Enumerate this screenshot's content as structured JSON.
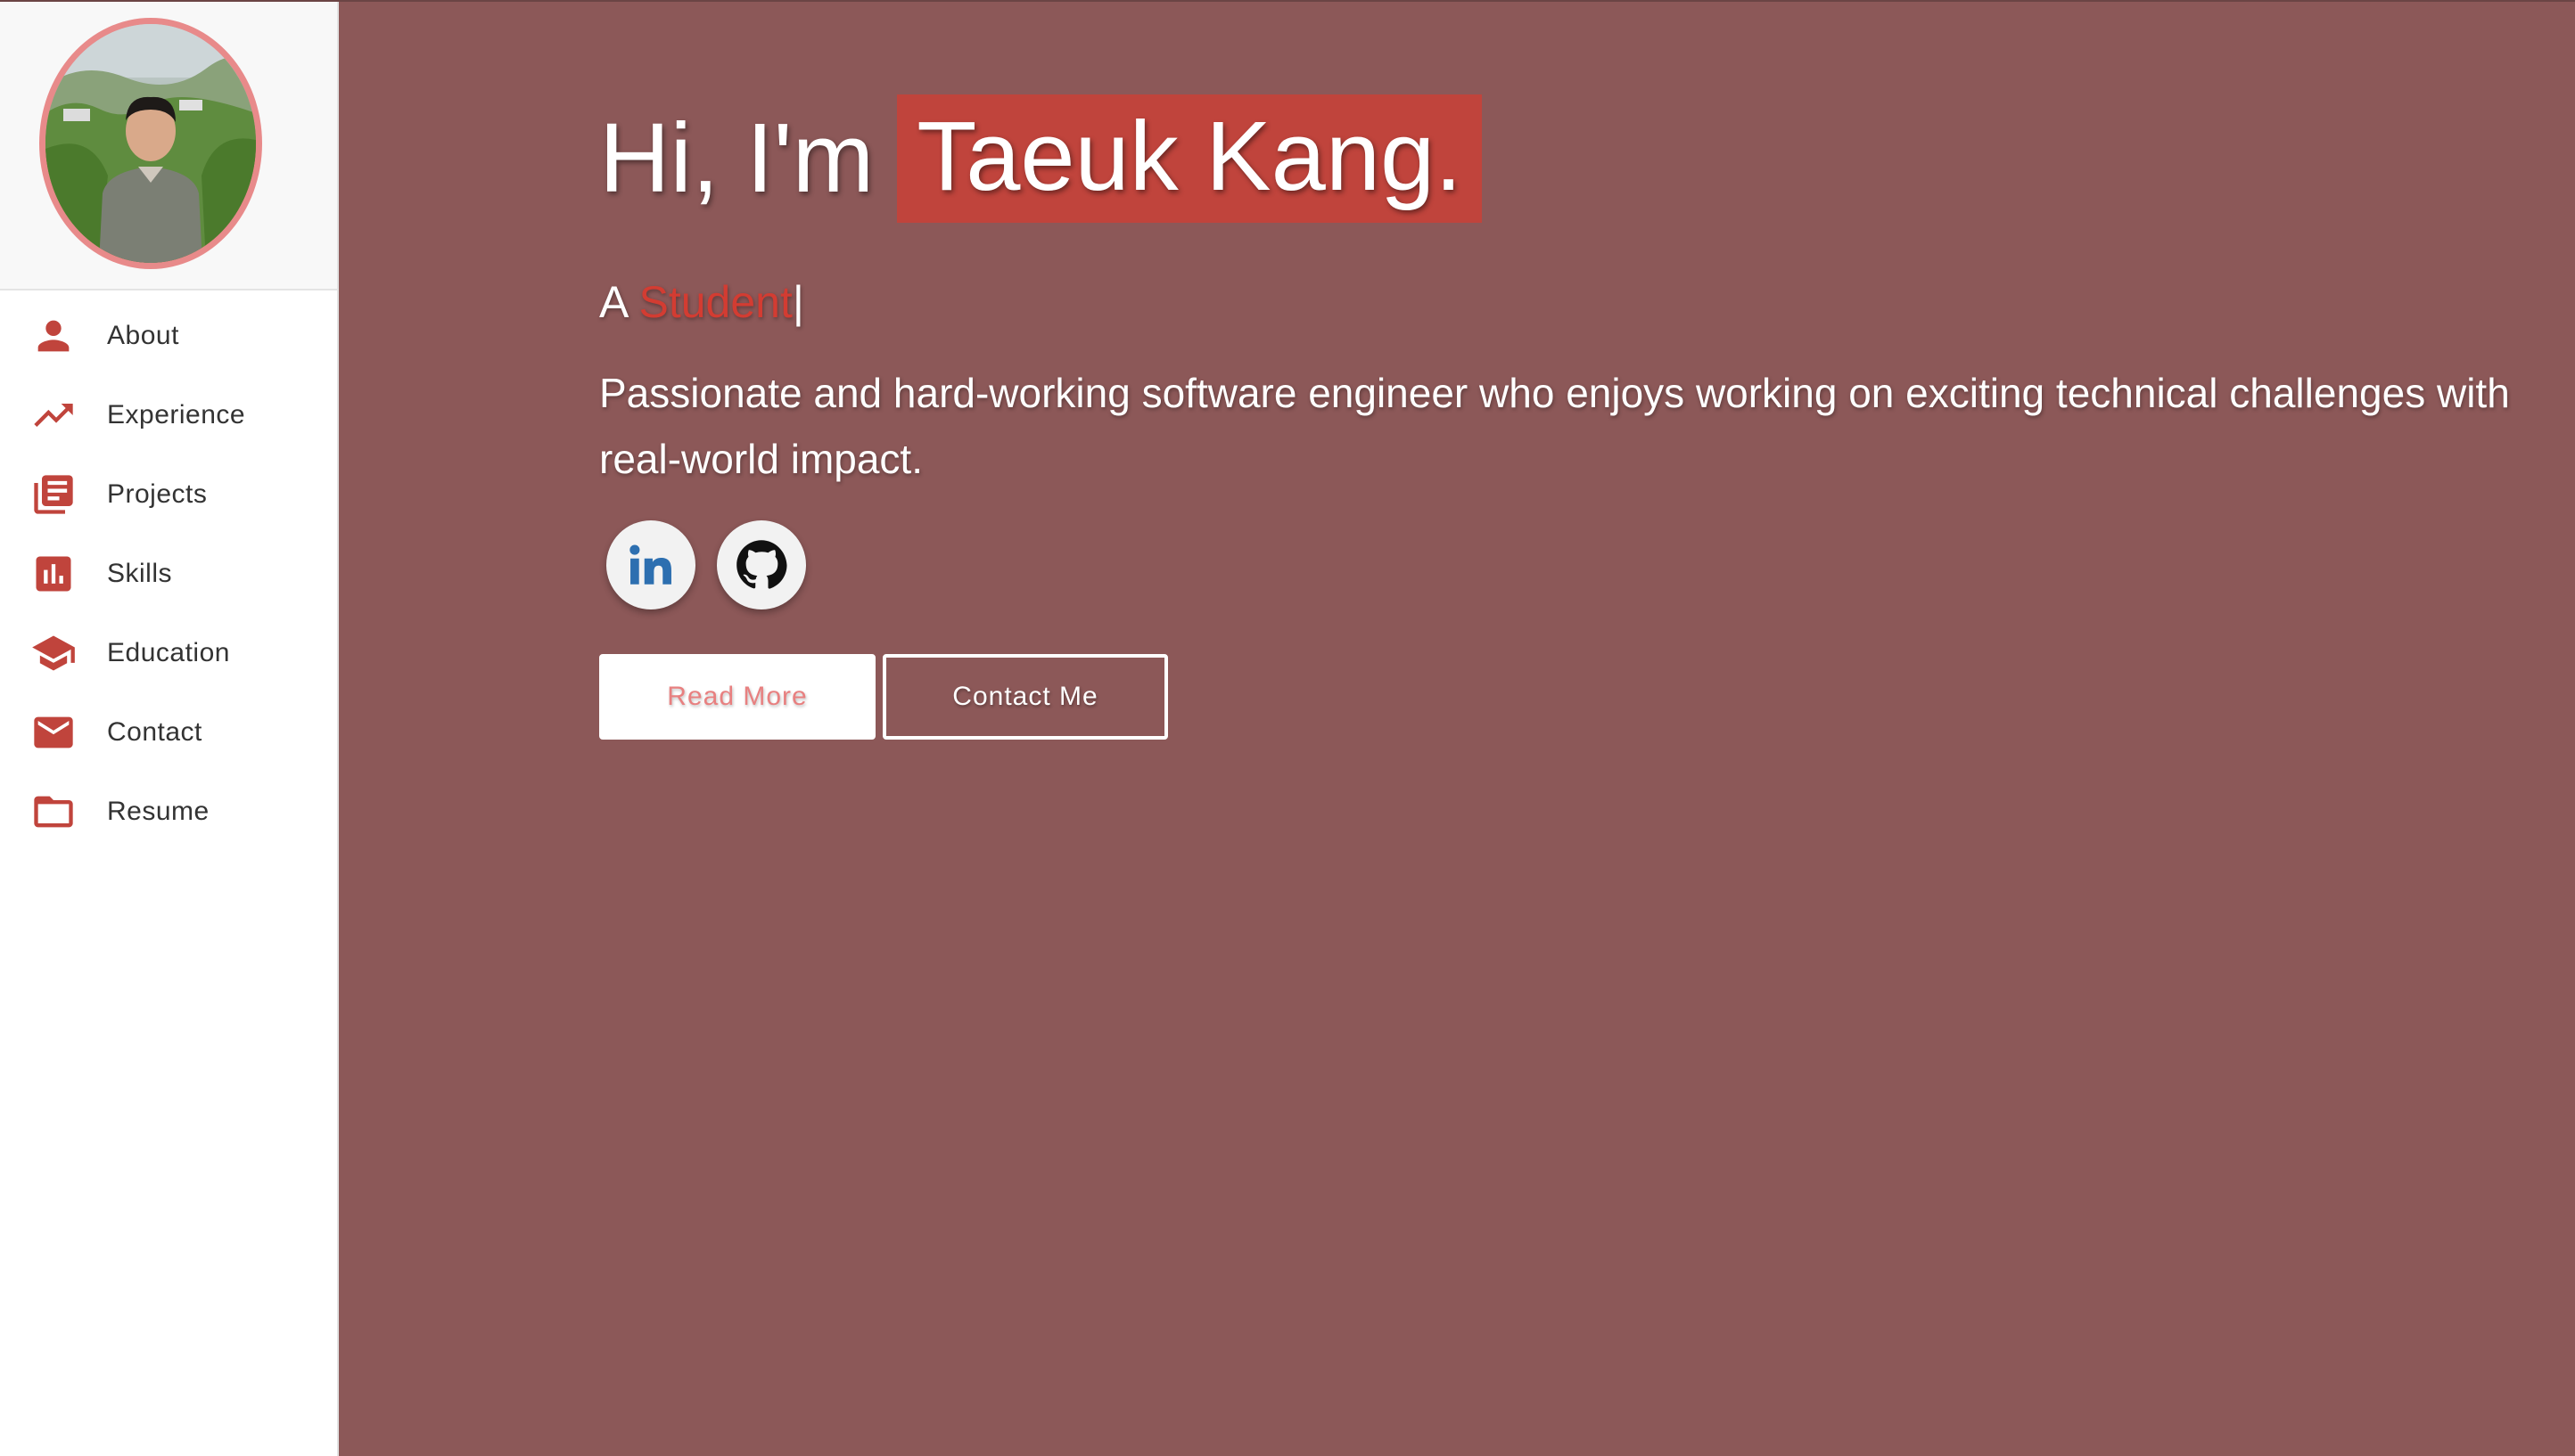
{
  "sidebar": {
    "items": [
      {
        "label": "About",
        "icon": "person-icon"
      },
      {
        "label": "Experience",
        "icon": "trending-up-icon"
      },
      {
        "label": "Projects",
        "icon": "library-books-icon"
      },
      {
        "label": "Skills",
        "icon": "bar-chart-icon"
      },
      {
        "label": "Education",
        "icon": "graduation-cap-icon"
      },
      {
        "label": "Contact",
        "icon": "mail-icon"
      },
      {
        "label": "Resume",
        "icon": "folder-icon"
      }
    ]
  },
  "hero": {
    "greeting": "Hi, I'm",
    "name": "Taeuk Kang.",
    "subtitle_prefix": "A",
    "subtitle_typed": "Student",
    "cursor": "|",
    "tagline": "Passionate and hard-working software engineer who enjoys working on exciting technical challenges with real-world impact.",
    "socials": [
      {
        "name": "LinkedIn",
        "icon": "linkedin-icon"
      },
      {
        "name": "GitHub",
        "icon": "github-icon"
      }
    ],
    "buttons": {
      "read_more": "Read More",
      "contact_me": "Contact Me"
    }
  },
  "colors": {
    "background": "#8c5858",
    "accent": "#c0443c",
    "avatar_border": "#e88a8a",
    "sidebar_bg": "#ffffff"
  }
}
